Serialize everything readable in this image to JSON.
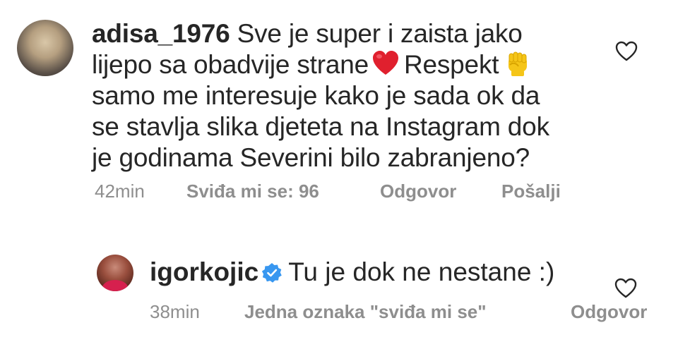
{
  "comments": [
    {
      "username": "adisa_1976",
      "text_line1": "Sve je super i zaista jako",
      "text_line2a": "lijepo sa obadvije strane",
      "text_line2b": "Respekt",
      "text_line3": "samo me interesuje kako je sada ok da",
      "text_line4": "se stavlja slika djeteta na Instagram dok",
      "text_line5": "je godinama Severini bilo zabranjeno?",
      "emoji_1": "heart-emoji",
      "emoji_2": "raised-fist-emoji",
      "time": "42min",
      "likes": "Sviđa mi se: 96",
      "reply_label": "Odgovor",
      "send_label": "Pošalji",
      "like_icon": "heart-outline-icon"
    },
    {
      "username": "igorkojic",
      "verified": true,
      "text": "Tu je dok ne nestane :)",
      "time": "38min",
      "likes": "Jedna oznaka \"sviđa mi se\"",
      "reply_label": "Odgovor",
      "like_icon": "heart-outline-icon"
    }
  ],
  "colors": {
    "text": "#262626",
    "meta": "#8e8e8e",
    "verified_badge": "#3897f0",
    "heart_emoji": "#e0202e",
    "fist_emoji": "#f5c518"
  }
}
